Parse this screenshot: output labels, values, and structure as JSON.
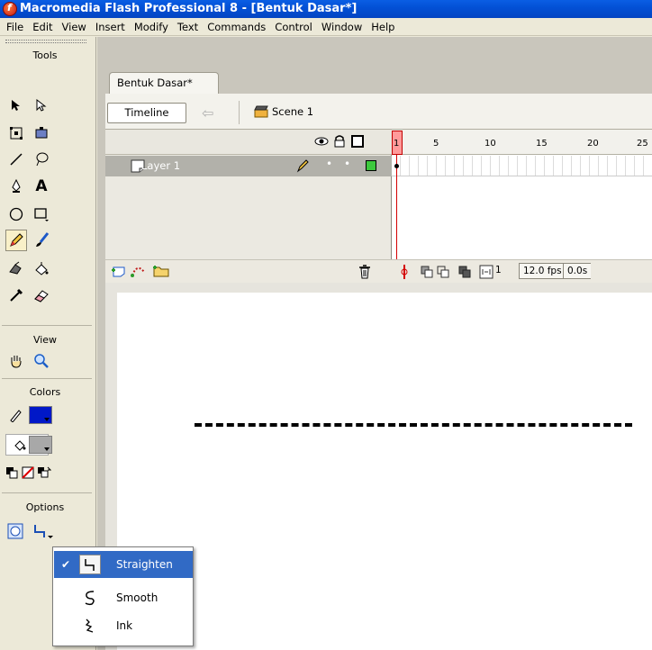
{
  "window": {
    "title": "Macromedia Flash Professional 8 - [Bentuk Dasar*]"
  },
  "menu": [
    "File",
    "Edit",
    "View",
    "Insert",
    "Modify",
    "Text",
    "Commands",
    "Control",
    "Window",
    "Help"
  ],
  "tools_panel": {
    "title": "Tools",
    "view_title": "View",
    "colors_title": "Colors",
    "options_title": "Options",
    "stroke_color": "#0018c8",
    "fill_color": "#a8a8a8"
  },
  "document": {
    "tab_label": "Bentuk Dasar*",
    "timeline_button": "Timeline",
    "scene_label": "Scene 1"
  },
  "timeline": {
    "layer_name": "Layer 1",
    "frame_numbers": [
      "1",
      "5",
      "10",
      "15",
      "20",
      "25"
    ],
    "current_frame": "1",
    "frame_rate": "12.0 fps",
    "elapsed_time": "0.0s",
    "layer_color": "#3dc93d"
  },
  "options_menu": {
    "items": [
      {
        "label": "Straighten",
        "icon": "straighten-icon",
        "selected": true
      },
      {
        "label": "Smooth",
        "icon": "smooth-icon",
        "selected": false
      },
      {
        "label": "Ink",
        "icon": "ink-icon",
        "selected": false
      }
    ]
  }
}
